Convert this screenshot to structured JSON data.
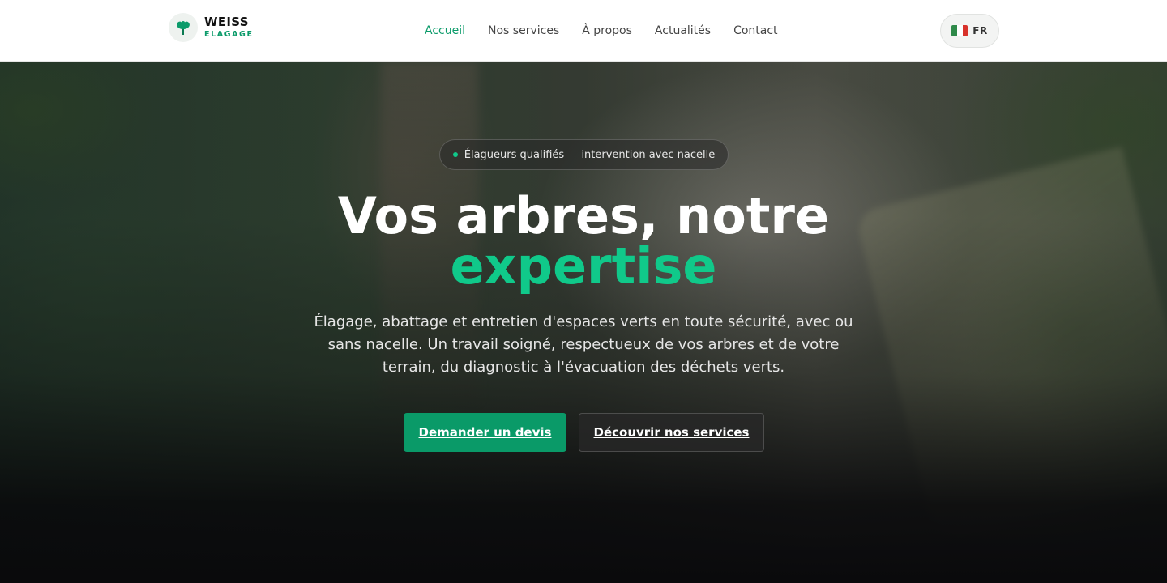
{
  "brand": {
    "name": "WEISS",
    "sub": "ELAGAGE",
    "icon": "tree-icon",
    "accent_color": "#0b9b6a"
  },
  "nav": {
    "items": [
      {
        "label": "Accueil",
        "active": true
      },
      {
        "label": "Nos services",
        "active": false
      },
      {
        "label": "À propos",
        "active": false
      },
      {
        "label": "Actualités",
        "active": false
      },
      {
        "label": "Contact",
        "active": false
      }
    ]
  },
  "lang": {
    "code": "FR",
    "flag_icon": "italian-flag-icon",
    "flag_colors": [
      "#2f8a4a",
      "#ffffff",
      "#d8322b"
    ]
  },
  "hero": {
    "badge": "Élagueurs qualifiés — intervention avec nacelle",
    "title_line1": "Vos arbres, notre",
    "title_line2": "expertise",
    "subtitle": "Élagage, abattage et entretien d'espaces verts en toute sécurité, avec ou sans nacelle. Un travail soigné, respectueux de vos arbres et de votre terrain, du diagnostic à l'évacuation des déchets verts.",
    "primary_button": "Demander un devis",
    "secondary_button": "Découvrir nos services",
    "highlight_color": "#10c98a",
    "button_color": "#0a9a68"
  }
}
